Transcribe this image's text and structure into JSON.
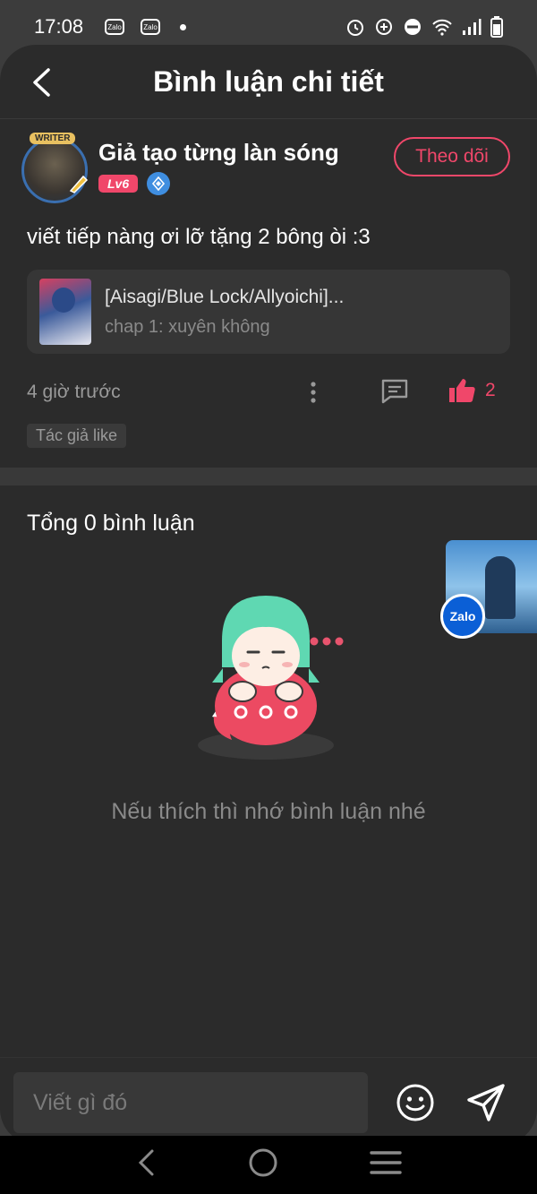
{
  "status_bar": {
    "time": "17:08",
    "notification_icons": [
      "Zalo",
      "Zalo"
    ],
    "right_icons": [
      "alarm-icon",
      "data-saver-icon",
      "dnd-icon",
      "wifi-icon",
      "signal-icon",
      "battery-icon"
    ]
  },
  "header": {
    "title": "Bình luận chi tiết",
    "back_icon": "chevron-left-icon"
  },
  "post": {
    "author_name": "Giả tạo từng làn sóng",
    "author_badge": "WRITER",
    "level": "Lv6",
    "follow_label": "Theo dõi",
    "comment": "viết tiếp nàng ơi lỡ tặng 2 bông òi :3",
    "chapter": {
      "title": "[Aisagi/Blue Lock/Allyoichi]...",
      "subtitle": "chap 1: xuyên không"
    },
    "time_ago": "4 giờ trước",
    "like_count": "2",
    "author_liked": "Tác giả like"
  },
  "comments": {
    "total_label": "Tổng 0 bình luận",
    "empty_message": "Nếu thích thì nhớ bình luận nhé"
  },
  "floating": {
    "app_label": "Zalo"
  },
  "input": {
    "placeholder": "Viết gì đó"
  },
  "colors": {
    "accent": "#f0476a",
    "background": "#2b2b2b",
    "card": "#363636"
  }
}
